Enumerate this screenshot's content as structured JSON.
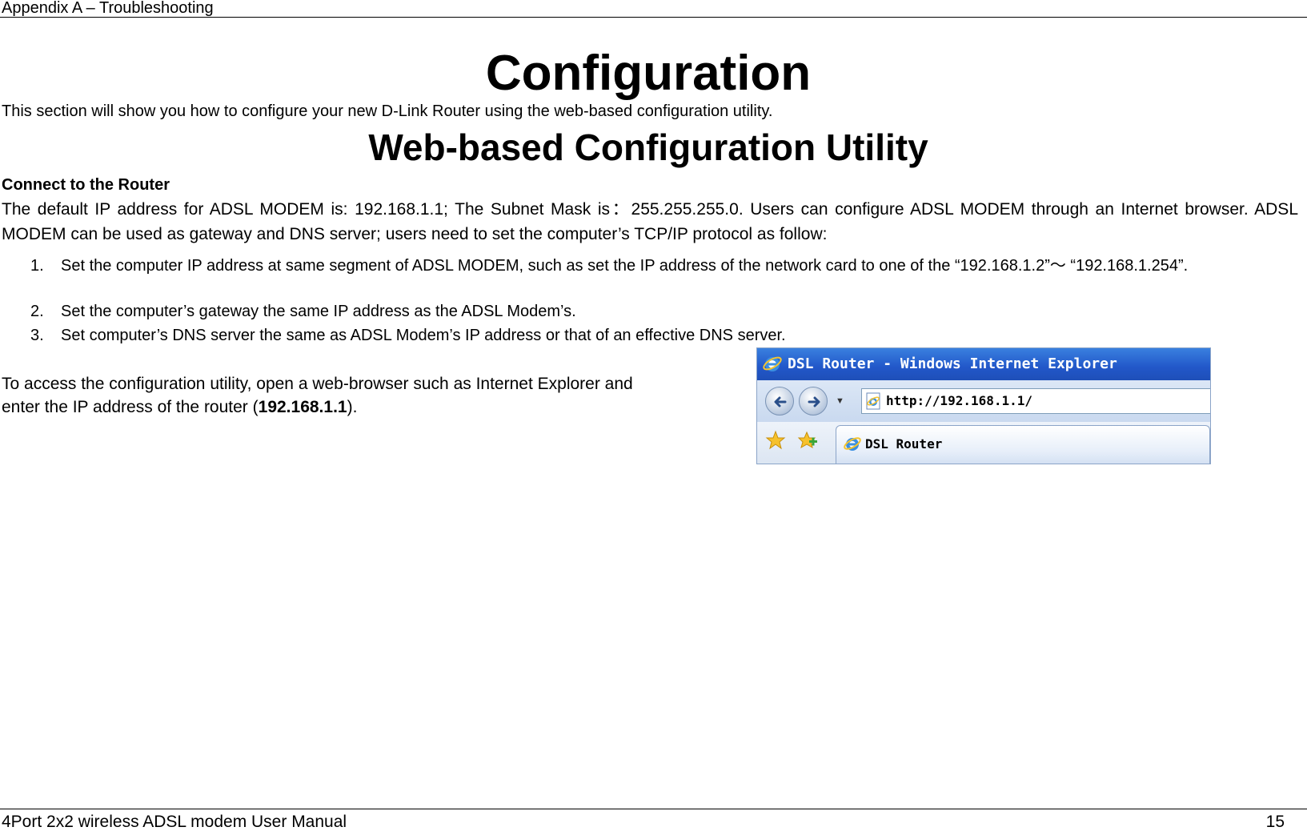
{
  "header": {
    "text": "Appendix A – Troubleshooting"
  },
  "title": "Configuration",
  "intro": "This section will show you how to configure your new D-Link Router using the web-based configuration utility.",
  "subtitle": "Web-based Configuration Utility",
  "section_heading": "Connect to the Router",
  "paragraph": "The default IP address for ADSL MODEM is: 192.168.1.1; The Subnet Mask is：255.255.255.0. Users can configure ADSL MODEM through an Internet browser. ADSL MODEM can be used as gateway and DNS server; users need to set the computer’s TCP/IP protocol as follow:",
  "list": [
    {
      "num": "1.",
      "text": "Set the computer IP address at same segment of ADSL MODEM, such as set the IP address of the network card to one of the “192.168.1.2”～ “192.168.1.254”."
    },
    {
      "num": "2.",
      "text": "Set the computer’s gateway the same IP address as the ADSL Modem’s."
    },
    {
      "num": "3.",
      "text": "Set computer’s DNS server the same as ADSL Modem’s IP address or that of an effective DNS server."
    }
  ],
  "access": {
    "text_before": "To access the configuration utility, open a web-browser such as Internet Explorer and enter the IP address of the router (",
    "ip_bold": "192.168.1.1",
    "text_after": ")."
  },
  "browser": {
    "window_title": "DSL Router - Windows Internet Explorer",
    "address_url": "http://192.168.1.1/",
    "tab_label": "DSL Router",
    "icons": [
      "ie-logo-icon",
      "back-arrow-icon",
      "forward-arrow-icon",
      "favorites-star-icon",
      "add-favorite-icon"
    ],
    "colors": {
      "titlebar": "#2257c9",
      "title_text": "#ffffff"
    }
  },
  "footer": {
    "manual_title": "4Port 2x2 wireless ADSL modem User Manual",
    "page_number": "15"
  }
}
